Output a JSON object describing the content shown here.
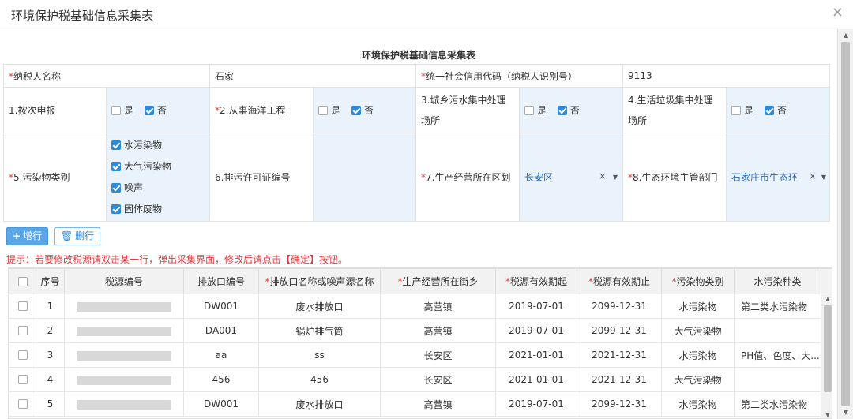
{
  "window": {
    "title": "环境保护税基础信息采集表",
    "close": "×"
  },
  "form": {
    "title": "环境保护税基础信息采集表",
    "taxpayer_name_label": "纳税人名称",
    "taxpayer_name_value": "石家",
    "credit_code_label": "统一社会信用代码（纳税人识别号）",
    "credit_code_value": "9113",
    "by_time_label": "1.按次申报",
    "marine_label": "2.从事海洋工程",
    "urban_sewage_label": "3.城乡污水集中处理场所",
    "garbage_label": "4.生活垃圾集中处理场所",
    "yes": "是",
    "no": "否",
    "pollutant_type_label": "5.污染物类别",
    "pollutants": [
      "水污染物",
      "大气污染物",
      "噪声",
      "固体废物"
    ],
    "permit_label": "6.排污许可证编号",
    "district_label": "7.生产经营所在区划",
    "district_value": "长安区",
    "env_dept_label": "8.生态环境主管部门",
    "env_dept_value": "石家庄市生态环",
    "clear": "×",
    "arrow": "▼"
  },
  "buttons": {
    "add": "增行",
    "delete": "删行",
    "add_icon": "+",
    "delete_icon": "🗑"
  },
  "tip": "提示：若要修改税源请双击某一行，弹出采集界面，修改后请点击【确定】按钮。",
  "table": {
    "headers": [
      "序号",
      "税源编号",
      "排放口编号",
      "排放口名称或噪声源名称",
      "生产经营所在街乡",
      "税源有效期起",
      "税源有效期止",
      "污染物类别",
      "水污染种类"
    ],
    "required": [
      false,
      false,
      false,
      true,
      true,
      true,
      true,
      true,
      false
    ],
    "rows": [
      {
        "no": "1",
        "outlet": "DW001",
        "name": "废水排放口",
        "street": "高营镇",
        "start": "2019-07-01",
        "end": "2099-12-31",
        "type": "水污染物",
        "water": "第二类水污染物"
      },
      {
        "no": "2",
        "outlet": "DA001",
        "name": "锅炉排气筒",
        "street": "高营镇",
        "start": "2019-07-01",
        "end": "2099-12-31",
        "type": "大气污染物",
        "water": ""
      },
      {
        "no": "3",
        "outlet": "aa",
        "name": "ss",
        "street": "长安区",
        "start": "2021-01-01",
        "end": "2021-12-31",
        "type": "水污染物",
        "water": "PH值、色度、大..."
      },
      {
        "no": "4",
        "outlet": "456",
        "name": "456",
        "street": "长安区",
        "start": "2021-01-01",
        "end": "2021-12-31",
        "type": "大气污染物",
        "water": ""
      },
      {
        "no": "5",
        "outlet": "DW001",
        "name": "废水排放口",
        "street": "高营镇",
        "start": "2019-07-01",
        "end": "2099-12-31",
        "type": "水污染物",
        "water": "第二类水污染物"
      }
    ]
  }
}
